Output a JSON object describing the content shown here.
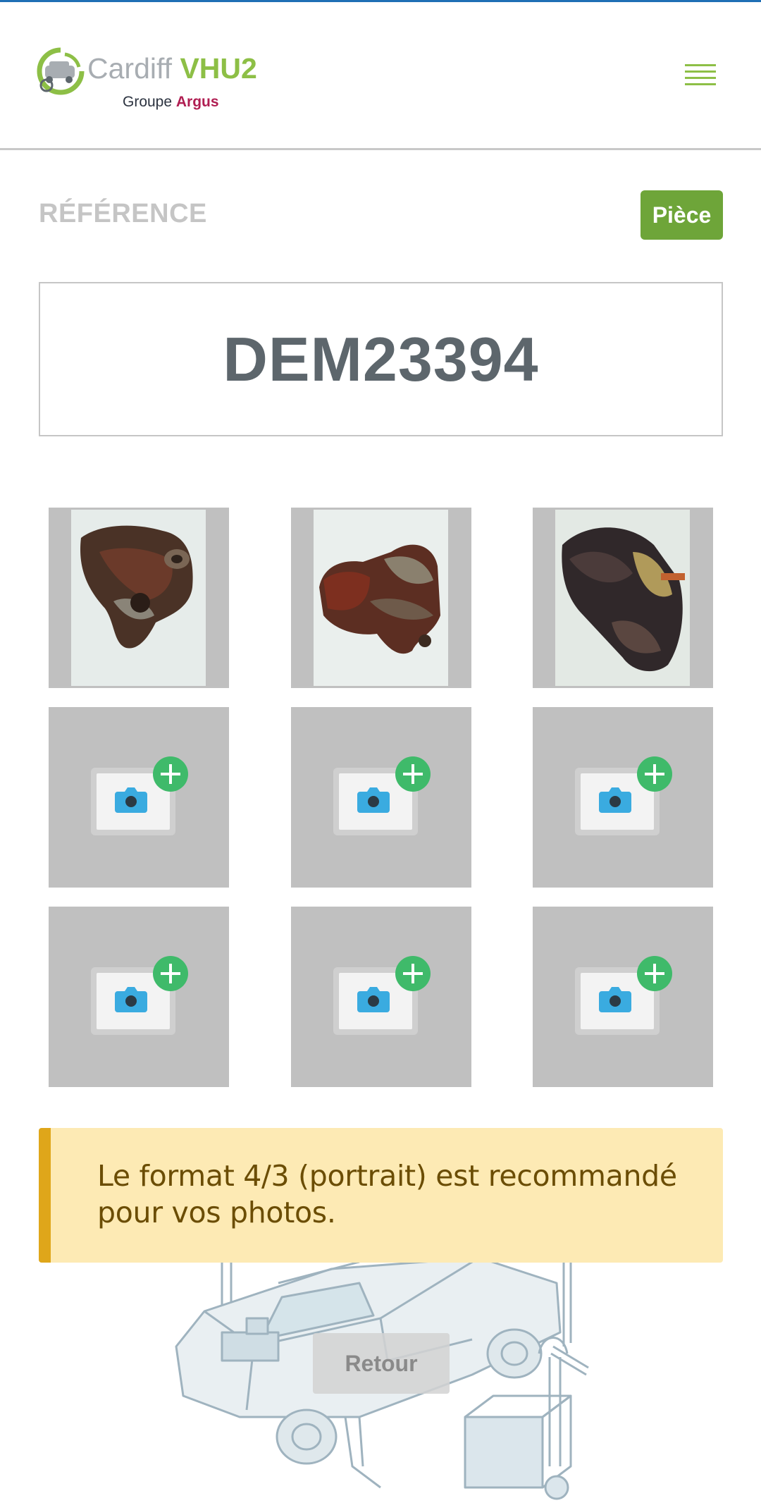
{
  "header": {
    "logo_name_part1": "Cardiff",
    "logo_name_part2": "VHU2",
    "logo_sub_part1": "Groupe",
    "logo_sub_part2": "Argus",
    "menu_icon": "hamburger-menu-icon"
  },
  "reference": {
    "label": "RÉFÉRENCE",
    "type_button": "Pièce",
    "value": "DEM23394"
  },
  "photos": {
    "filled": [
      {
        "alt": "photo-1"
      },
      {
        "alt": "photo-2"
      },
      {
        "alt": "photo-3"
      }
    ],
    "empty_slot_count": 6,
    "add_icon": "camera-add-icon"
  },
  "notice": {
    "text": "Le format 4/3 (portrait) est recommandé pour vos photos."
  },
  "footer": {
    "back_button": "Retour"
  },
  "colors": {
    "brand_green": "#8dbf46",
    "button_green": "#6ea539",
    "brand_red": "#b01e52",
    "notice_bg": "#fdeab4",
    "notice_border": "#dfa61a",
    "add_plus": "#3fba6a",
    "camera_blue": "#3aabe0"
  }
}
